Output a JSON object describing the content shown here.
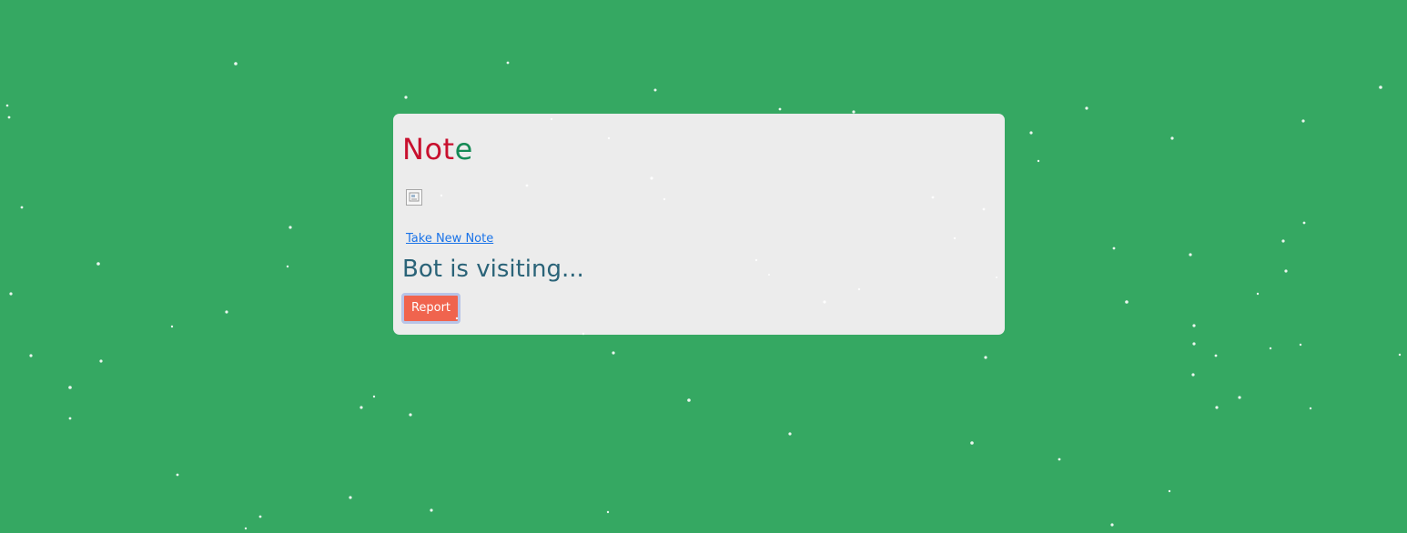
{
  "card": {
    "title_letters": [
      {
        "char": "N",
        "color": "#c8102e"
      },
      {
        "char": "o",
        "color": "#c8102e"
      },
      {
        "char": "t",
        "color": "#c8102e"
      },
      {
        "char": "e",
        "color": "#158a55"
      }
    ],
    "broken_image_icon": "broken-image-icon",
    "new_note_link": "Take New Note",
    "status": "Bot is visiting...",
    "report_button": "Report"
  },
  "colors": {
    "background": "#35a862",
    "card": "#ececec",
    "link": "#1a73e8",
    "status_text": "#2a6378",
    "button": "#f0644e",
    "button_focus_ring": "#b8c4e8",
    "snow": "#ffffff"
  }
}
